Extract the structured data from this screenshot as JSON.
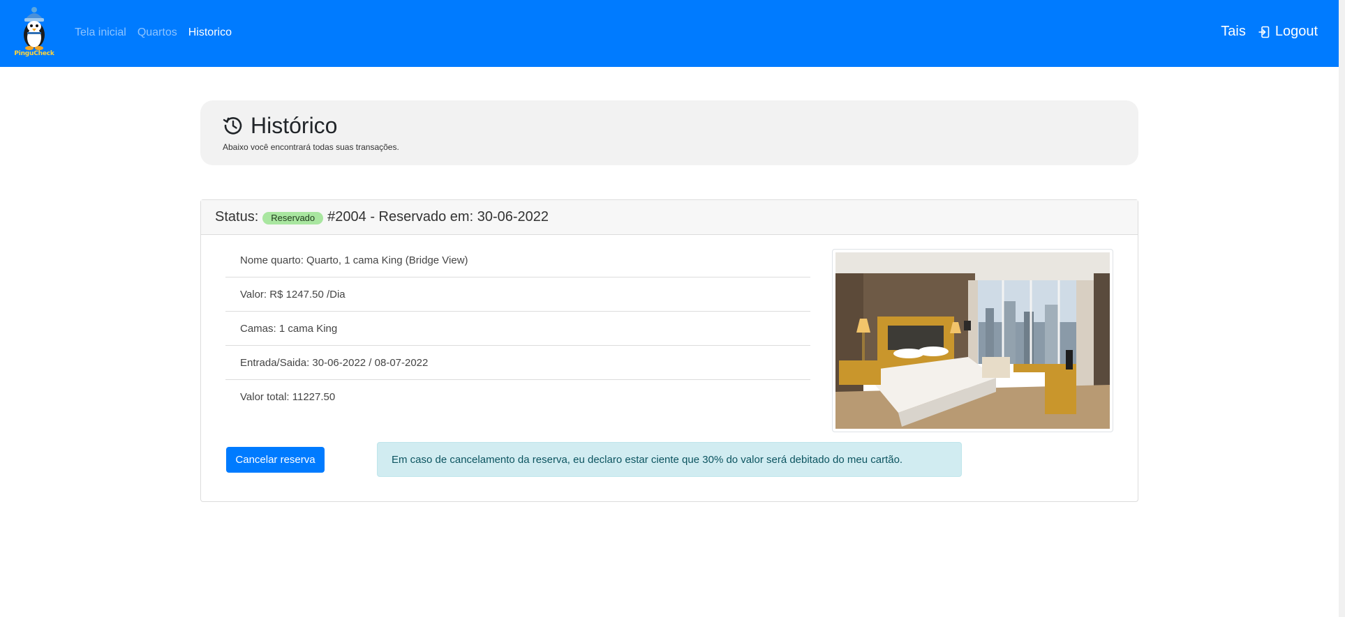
{
  "navbar": {
    "brand_text": "PinguCheck",
    "links": [
      {
        "label": "Tela inicial"
      },
      {
        "label": "Quartos"
      },
      {
        "label": "Historico"
      }
    ],
    "user_name": "Tais",
    "logout_label": "Logout",
    "icons": {
      "logout": "logout-icon",
      "brand": "penguin-logo"
    },
    "colors": {
      "bar": "#007bff"
    }
  },
  "jumbotron": {
    "icon": "history-icon",
    "title": "Histórico",
    "subtitle": "Abaixo você encontrará todas suas transações."
  },
  "reservation": {
    "status_label": "Status:",
    "status_badge": "Reservado",
    "header_text": "#2004 - Reservado em: 30-06-2022",
    "details": [
      "Nome quarto: Quarto, 1 cama King (Bridge View)",
      "Valor: R$ 1247.50 /Dia",
      "Camas: 1 cama King",
      "Entrada/Saida: 30-06-2022 / 08-07-2022",
      "Valor total: 11227.50"
    ],
    "cancel_button": "Cancelar reserva",
    "notice": "Em caso de cancelamento da reserva, eu declaro estar ciente que 30% do valor será debitado do meu cartão.",
    "colors": {
      "badge": "#a9e6a0",
      "button": "#007bff",
      "notice_bg": "#d1ecf1"
    }
  }
}
